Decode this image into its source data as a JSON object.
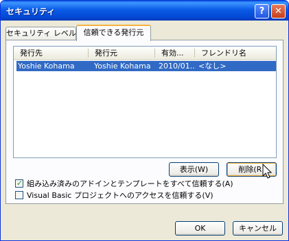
{
  "window": {
    "title": "セキュリティ",
    "help_label": "?",
    "close_label": "✕"
  },
  "tabs": [
    {
      "label": "セキュリティ レベル"
    },
    {
      "label": "信頼できる発行元"
    }
  ],
  "list": {
    "columns": [
      "発行先",
      "発行元",
      "有効...",
      "フレンドリ名"
    ],
    "rows": [
      {
        "issued_to": "Yoshie Kohama",
        "issued_by": "Yoshie Kohama",
        "expires": "2010/01...",
        "friendly": "<なし>"
      }
    ]
  },
  "buttons": {
    "view": "表示(W)",
    "remove": "削除(R)",
    "ok": "OK",
    "cancel": "キャンセル"
  },
  "options": [
    {
      "label": "組み込み済みのアドインとテンプレートをすべて信頼する(A)",
      "checked": true,
      "mark": "✓"
    },
    {
      "label": "Visual Basic プロジェクトへのアクセスを信頼する(V)",
      "checked": false,
      "mark": ""
    }
  ]
}
